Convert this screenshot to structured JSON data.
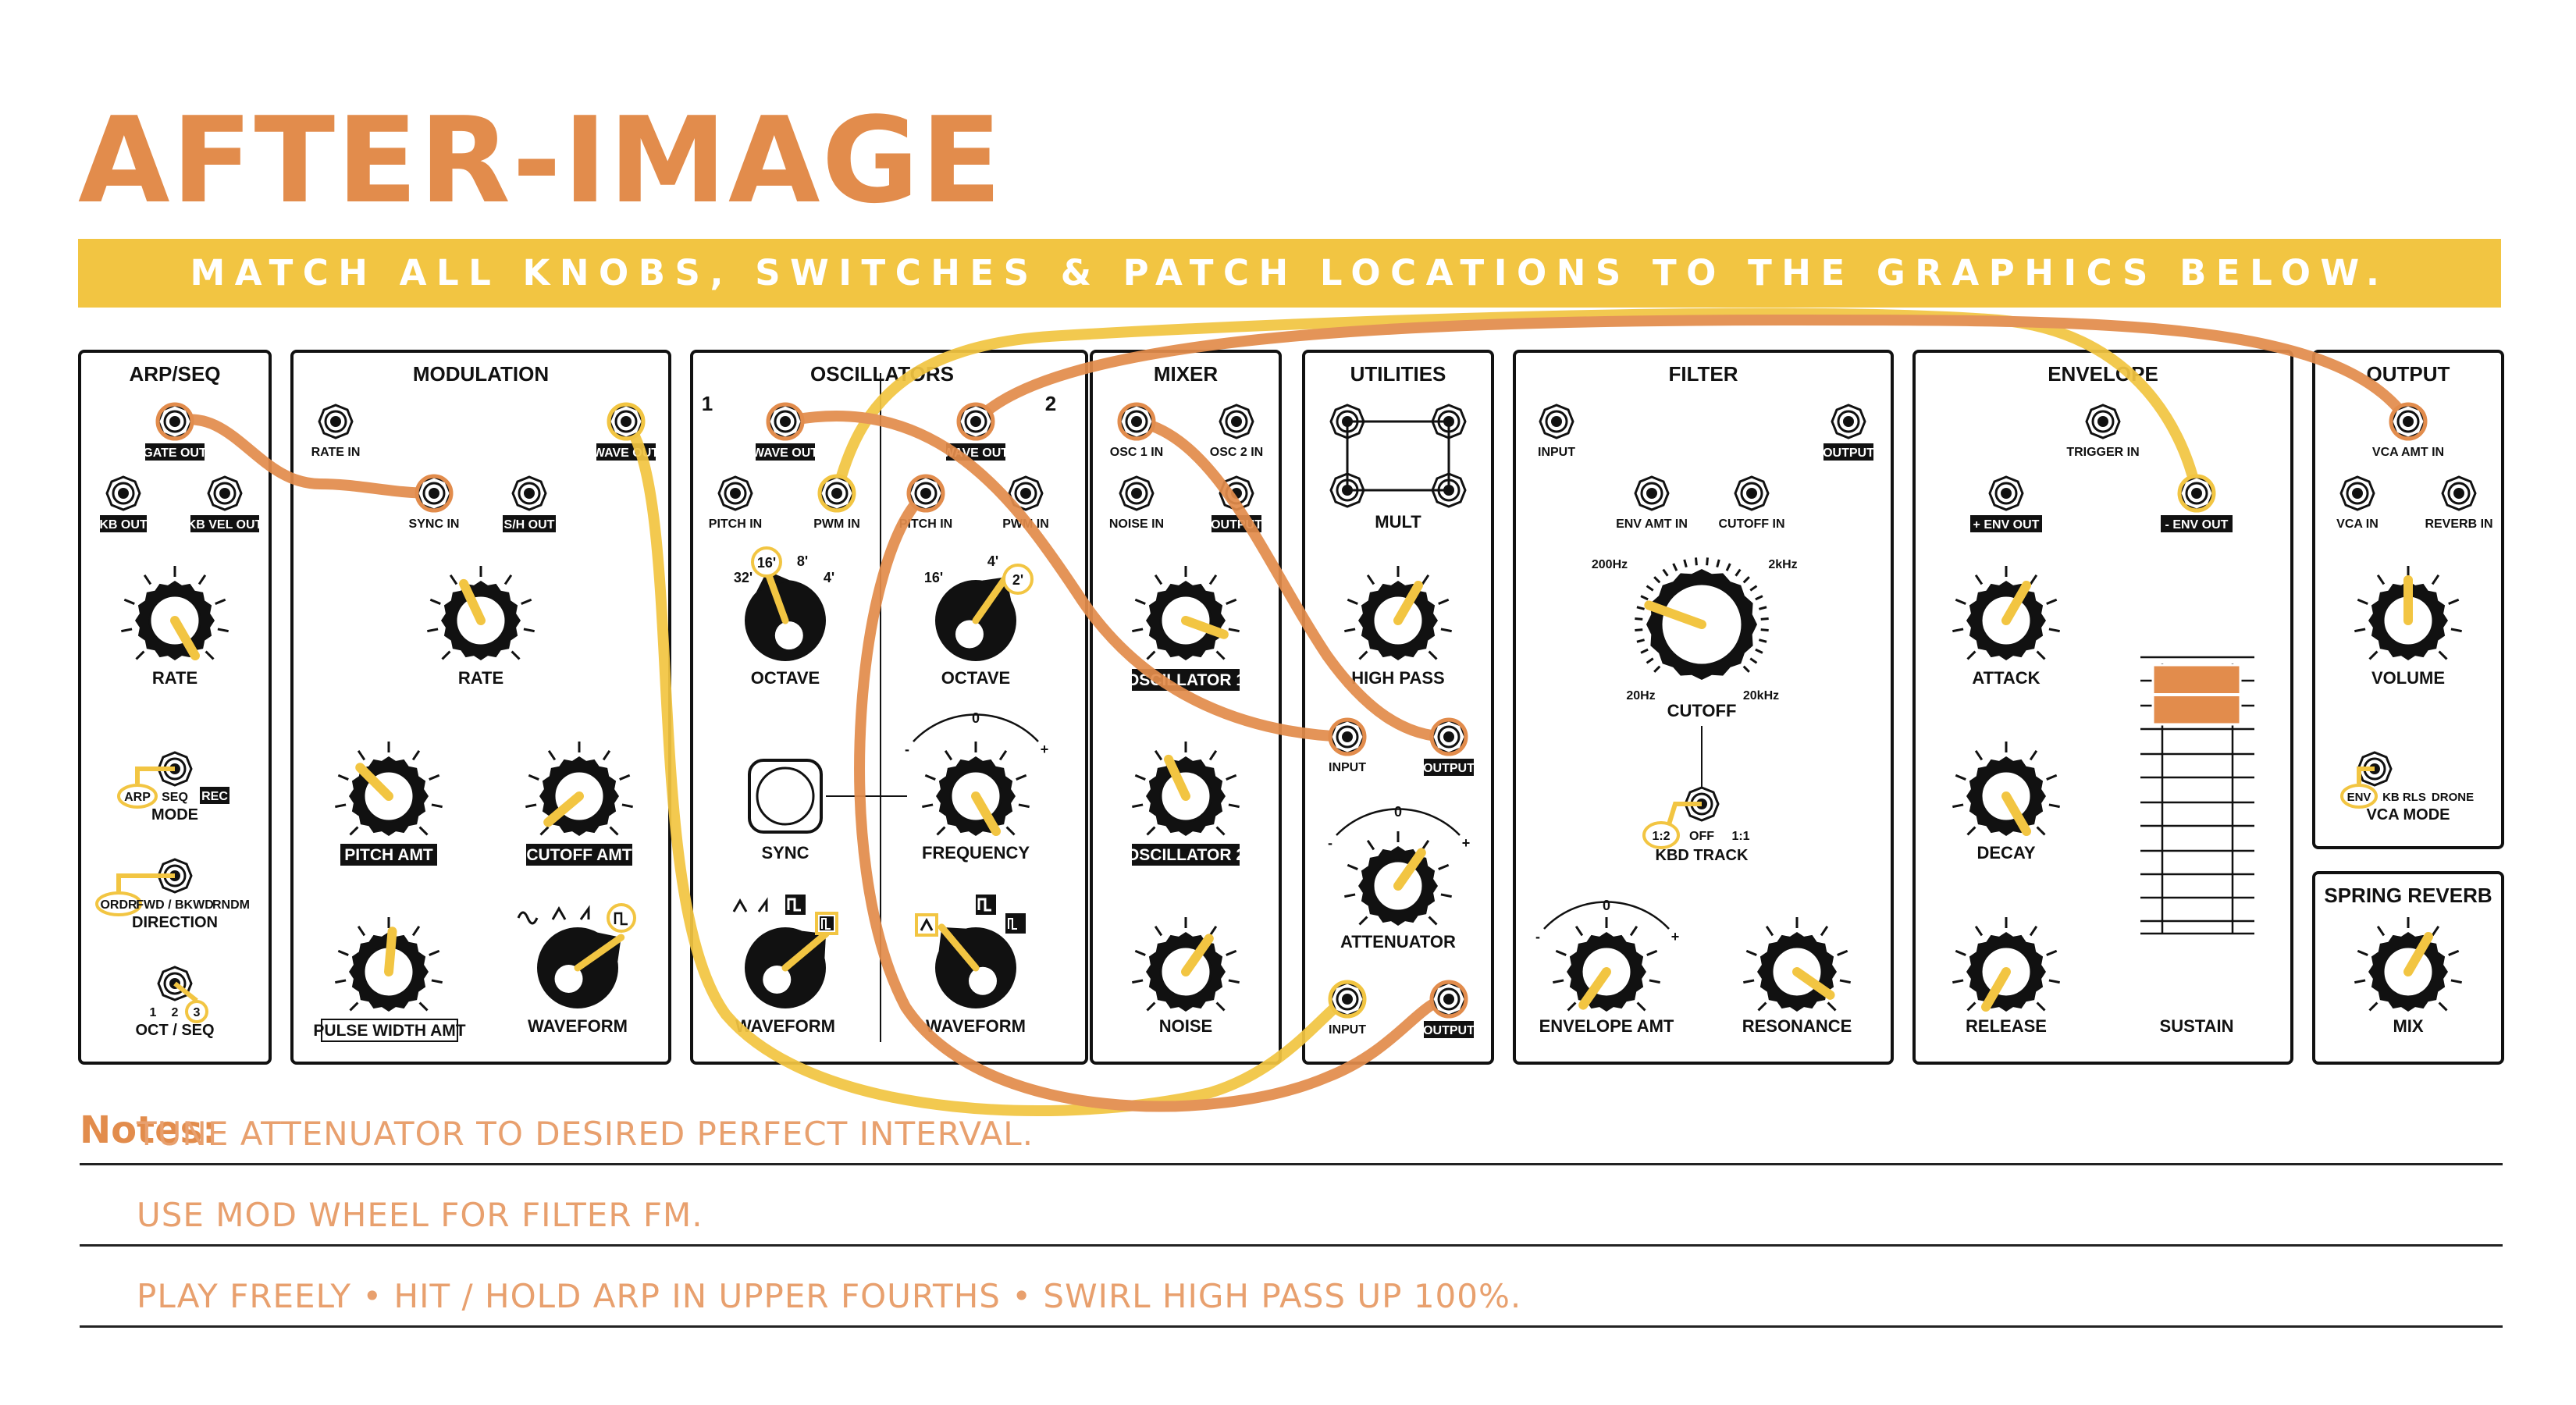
{
  "title": "AFTER-IMAGE",
  "banner": "MATCH ALL KNOBS, SWITCHES & PATCH LOCATIONS TO THE GRAPHICS BELOW.",
  "colors": {
    "orange": "#e28c4c",
    "yellow": "#f2c542",
    "ink": "#111111",
    "note_text": "#e8a06e"
  },
  "panels": {
    "arp_seq": "ARP/SEQ",
    "modulation": "MODULATION",
    "oscillators": "OSCILLATORS",
    "mixer": "MIXER",
    "utilities": "UTILITIES",
    "filter": "FILTER",
    "envelope": "ENVELOPE",
    "output": "OUTPUT",
    "spring_reverb": "SPRING REVERB"
  },
  "osc_numbers": {
    "one": "1",
    "two": "2"
  },
  "jacks": {
    "gate_out": "GATE OUT",
    "kb_out": "KB OUT",
    "kb_vel_out": "KB VEL OUT",
    "rate_in": "RATE IN",
    "sync_in": "SYNC IN",
    "sh_out": "S/H OUT",
    "mod_wave_out": "WAVE OUT",
    "osc1_wave_out": "WAVE OUT",
    "osc1_pitch_in": "PITCH IN",
    "osc1_pwm_in": "PWM IN",
    "osc2_wave_out": "WAVE OUT",
    "osc2_pitch_in": "PITCH IN",
    "osc2_pwm_in": "PWM IN",
    "osc1_in": "OSC 1 IN",
    "osc2_in": "OSC 2 IN",
    "noise_in": "NOISE IN",
    "mixer_output": "OUTPUT",
    "hp_input": "INPUT",
    "hp_output": "OUTPUT",
    "att_input": "INPUT",
    "att_output": "OUTPUT",
    "filter_input": "INPUT",
    "filter_output": "OUTPUT",
    "env_amt_in": "ENV AMT IN",
    "cutoff_in": "CUTOFF IN",
    "trigger_in": "TRIGGER IN",
    "plus_env_out": "+ ENV OUT",
    "minus_env_out": "- ENV OUT",
    "vca_amt_in": "VCA AMT IN",
    "vca_in": "VCA IN",
    "reverb_in": "REVERB IN"
  },
  "knobs": {
    "arp_rate": "RATE",
    "mod_rate": "RATE",
    "pitch_amt": "PITCH AMT",
    "cutoff_amt": "CUTOFF AMT",
    "pulse_width_amt": "PULSE WIDTH AMT",
    "mod_waveform": "WAVEFORM",
    "osc1_octave": "OCTAVE",
    "osc2_octave": "OCTAVE",
    "osc1_waveform": "WAVEFORM",
    "osc2_waveform": "WAVEFORM",
    "frequency": "FREQUENCY",
    "sync": "SYNC",
    "oscillator1": "OSCILLATOR 1",
    "oscillator2": "OSCILLATOR 2",
    "noise": "NOISE",
    "high_pass": "HIGH PASS",
    "attenuator": "ATTENUATOR",
    "mult": "MULT",
    "cutoff": "CUTOFF",
    "envelope_amt": "ENVELOPE AMT",
    "resonance": "RESONANCE",
    "attack": "ATTACK",
    "decay": "DECAY",
    "release": "RELEASE",
    "sustain": "SUSTAIN",
    "volume": "VOLUME",
    "mix": "MIX"
  },
  "octave_marks": {
    "o32": "32'",
    "o16": "16'",
    "o8": "8'",
    "o4": "4'",
    "o2": "2'"
  },
  "freq_marks": {
    "zero": "0",
    "minus": "-",
    "plus": "+"
  },
  "cutoff_marks": {
    "hz200": "200Hz",
    "khz2": "2kHz",
    "hz20": "20Hz",
    "khz20": "20kHz"
  },
  "switches": {
    "arp": "ARP",
    "seq": "SEQ",
    "rec": "REC",
    "mode": "MODE",
    "ordr": "ORDR",
    "fwd_bkwd": "FWD / BKWD",
    "rndm": "RNDM",
    "direction": "DIRECTION",
    "one": "1",
    "two": "2",
    "three": "3",
    "oct_seq": "OCT / SEQ",
    "r12": "1:2",
    "off": "OFF",
    "r11": "1:1",
    "kbd_track": "KBD TRACK",
    "env": "ENV",
    "kb_rls": "KB RLS",
    "drone": "DRONE",
    "vca_mode": "VCA MODE"
  },
  "notes": {
    "label": "Notes:",
    "line1": "TUNE ATTENUATOR TO DESIRED PERFECT INTERVAL.",
    "line2": "USE MOD WHEEL FOR FILTER FM.",
    "line3": "PLAY FREELY • HIT / HOLD ARP IN UPPER FOURTHS • SWIRL HIGH PASS UP 100%."
  }
}
